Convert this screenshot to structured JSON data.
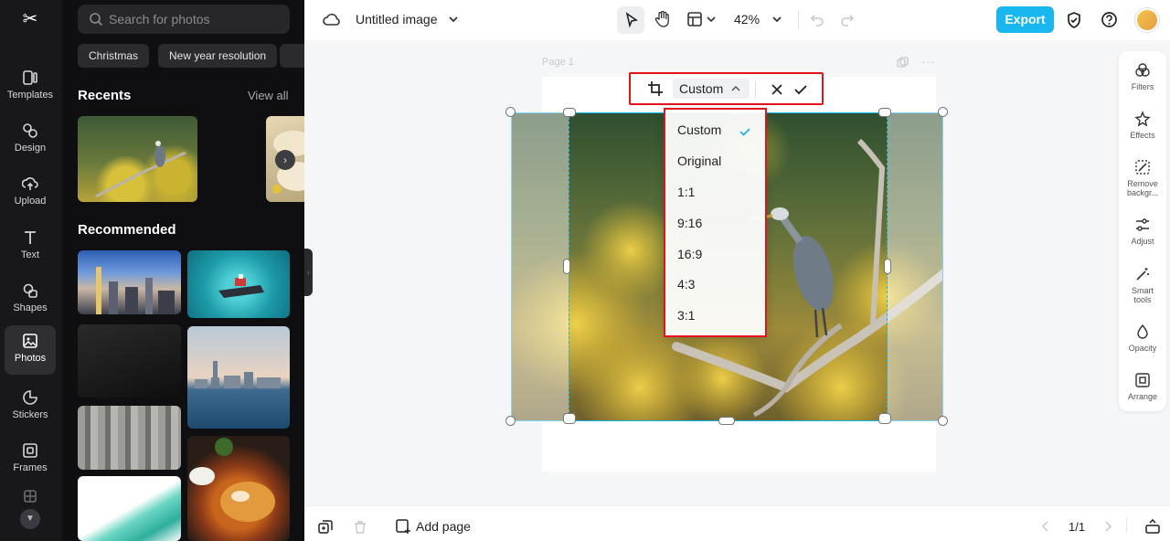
{
  "app": {
    "logo_glyph": "✂",
    "document_title": "Untitled image",
    "zoom_level": "42%",
    "export_label": "Export",
    "page_label": "Page 1",
    "add_page_label": "Add page",
    "page_counter": "1/1"
  },
  "rail": {
    "items": [
      {
        "label": "Templates",
        "icon": "templates-icon"
      },
      {
        "label": "Design",
        "icon": "design-icon"
      },
      {
        "label": "Upload",
        "icon": "upload-icon"
      },
      {
        "label": "Text",
        "icon": "text-icon"
      },
      {
        "label": "Shapes",
        "icon": "shapes-icon"
      },
      {
        "label": "Photos",
        "icon": "photos-icon",
        "active": true
      },
      {
        "label": "Stickers",
        "icon": "stickers-icon"
      },
      {
        "label": "Frames",
        "icon": "frames-icon"
      }
    ]
  },
  "panel": {
    "search_placeholder": "Search for photos",
    "chips": [
      "Christmas",
      "New year resolution"
    ],
    "recents_title": "Recents",
    "view_all_label": "View all",
    "recommended_title": "Recommended"
  },
  "crop": {
    "selected_ratio": "Custom",
    "ratio_options": [
      "Custom",
      "Original",
      "1:1",
      "9:16",
      "16:9",
      "4:3",
      "3:1"
    ]
  },
  "tools": [
    {
      "label": "Filters",
      "icon": "filters-icon"
    },
    {
      "label": "Effects",
      "icon": "effects-icon"
    },
    {
      "label": "Remove backgr...",
      "icon": "remove-background-icon"
    },
    {
      "label": "Adjust",
      "icon": "adjust-icon"
    },
    {
      "label": "Smart tools",
      "icon": "smart-tools-icon"
    },
    {
      "label": "Opacity",
      "icon": "opacity-icon"
    },
    {
      "label": "Arrange",
      "icon": "arrange-icon"
    }
  ],
  "colors": {
    "accent": "#18b7f0",
    "highlight_box": "#e1141b",
    "rail_bg": "#18181b",
    "panel_bg": "#0f0f11"
  }
}
